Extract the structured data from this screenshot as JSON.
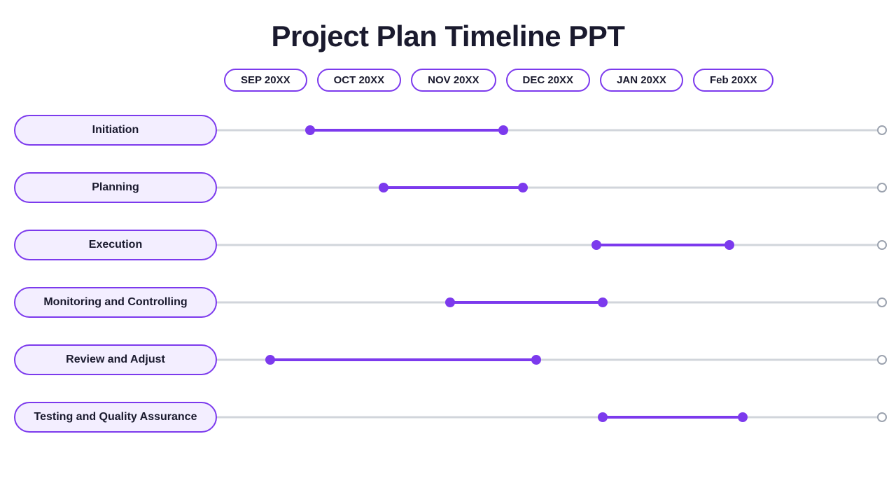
{
  "title": "Project Plan Timeline PPT",
  "months": [
    {
      "label": "SEP 20XX"
    },
    {
      "label": "OCT 20XX"
    },
    {
      "label": "NOV 20XX"
    },
    {
      "label": "DEC 20XX"
    },
    {
      "label": "JAN 20XX"
    },
    {
      "label": "Feb 20XX"
    }
  ],
  "rows": [
    {
      "id": "initiation",
      "label": "Initiation",
      "segStart": 14.0,
      "segEnd": 43.0
    },
    {
      "id": "planning",
      "label": "Planning",
      "segStart": 25.0,
      "segEnd": 46.0
    },
    {
      "id": "execution",
      "label": "Execution",
      "segStart": 57.0,
      "segEnd": 77.0
    },
    {
      "id": "monitoring",
      "label": "Monitoring and Controlling",
      "segStart": 35.0,
      "segEnd": 58.0
    },
    {
      "id": "review",
      "label": "Review and Adjust",
      "segStart": 8.0,
      "segEnd": 48.0
    },
    {
      "id": "testing",
      "label": "Testing and Quality Assurance",
      "segStart": 58.0,
      "segEnd": 79.0
    }
  ]
}
